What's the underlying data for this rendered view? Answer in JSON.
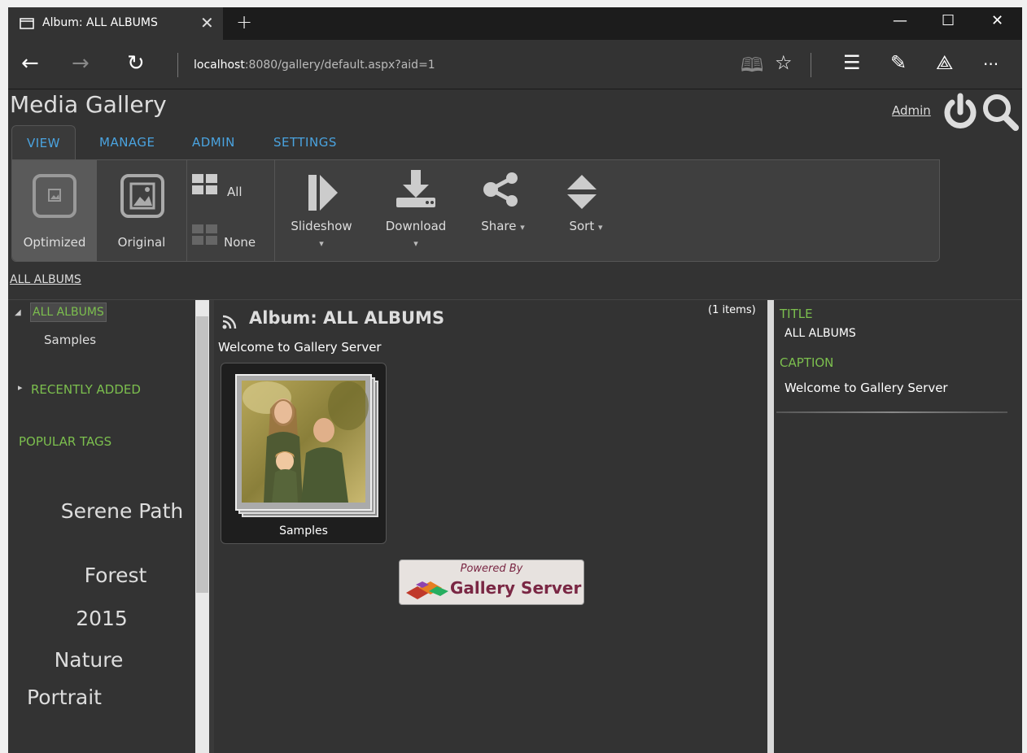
{
  "browser": {
    "tab_title": "Album: ALL ALBUMS",
    "close_glyph": "✕",
    "newtab_glyph": "+",
    "minimize_glyph": "—",
    "maximize_glyph": "☐",
    "close_window_glyph": "✕",
    "back_glyph": "←",
    "forward_glyph": "→",
    "refresh_glyph": "↻",
    "url_host": "localhost",
    "url_rest": ":8080/gallery/default.aspx?aid=1",
    "reading_glyph": "🕮",
    "favorite_glyph": "☆",
    "hub_glyph": "☰",
    "note_glyph": "✎",
    "share_glyph": "⟁",
    "more_glyph": "···"
  },
  "header": {
    "site_title": "Media Gallery",
    "admin_link": "Admin"
  },
  "ribbon": {
    "tabs": [
      "VIEW",
      "MANAGE",
      "ADMIN",
      "SETTINGS"
    ],
    "optimized_label": "Optimized",
    "original_label": "Original",
    "all_label": "All",
    "none_label": "None",
    "slideshow_label": "Slideshow",
    "download_label": "Download",
    "share_label": "Share",
    "sort_label": "Sort",
    "caret": "▾"
  },
  "breadcrumb": "ALL ALBUMS",
  "tree": {
    "all_albums": "ALL ALBUMS",
    "samples": "Samples",
    "recently_added": "RECENTLY ADDED",
    "popular_tags": "POPULAR TAGS",
    "expanded_glyph": "◢",
    "collapsed_glyph": "▸"
  },
  "tags": [
    "Serene Path",
    "Forest",
    "2015",
    "Nature",
    "Portrait"
  ],
  "album": {
    "heading": "Album: ALL ALBUMS",
    "item_count": "(1 items)",
    "description": "Welcome to Gallery Server",
    "thumbnail_caption": "Samples",
    "powered_by": "Powered By",
    "powered_brand": "Gallery Server"
  },
  "details": {
    "title_label": "TITLE",
    "title_value": "ALL ALBUMS",
    "caption_label": "CAPTION",
    "caption_value": "Welcome to Gallery Server"
  }
}
